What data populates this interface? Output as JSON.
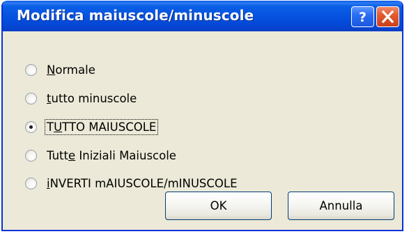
{
  "window": {
    "title": "Modifica maiuscole/minuscole"
  },
  "titlebar_buttons": {
    "help_icon": "question-mark",
    "close_icon": "x-close"
  },
  "options": [
    {
      "label_before": "",
      "mnemonic": "N",
      "label_after": "ormale",
      "checked": false,
      "focused": false
    },
    {
      "label_before": "",
      "mnemonic": "t",
      "label_after": "utto minuscole",
      "checked": false,
      "focused": false
    },
    {
      "label_before": "T",
      "mnemonic": "U",
      "label_after": "TTO MAIUSCOLE",
      "checked": true,
      "focused": true
    },
    {
      "label_before": "Tutt",
      "mnemonic": "e",
      "label_after": " Iniziali Maiuscole",
      "checked": false,
      "focused": false
    },
    {
      "label_before": "",
      "mnemonic": "i",
      "label_after": "NVERTI mAIUSCOLE/mINUSCOLE",
      "checked": false,
      "focused": false
    }
  ],
  "buttons": {
    "ok_label": "OK",
    "cancel_label": "Annulla"
  },
  "colors": {
    "titlebar": "#0553e0",
    "dialog_bg": "#ece9d8",
    "close_button": "#e55a2e",
    "help_button": "#2a6df4"
  }
}
